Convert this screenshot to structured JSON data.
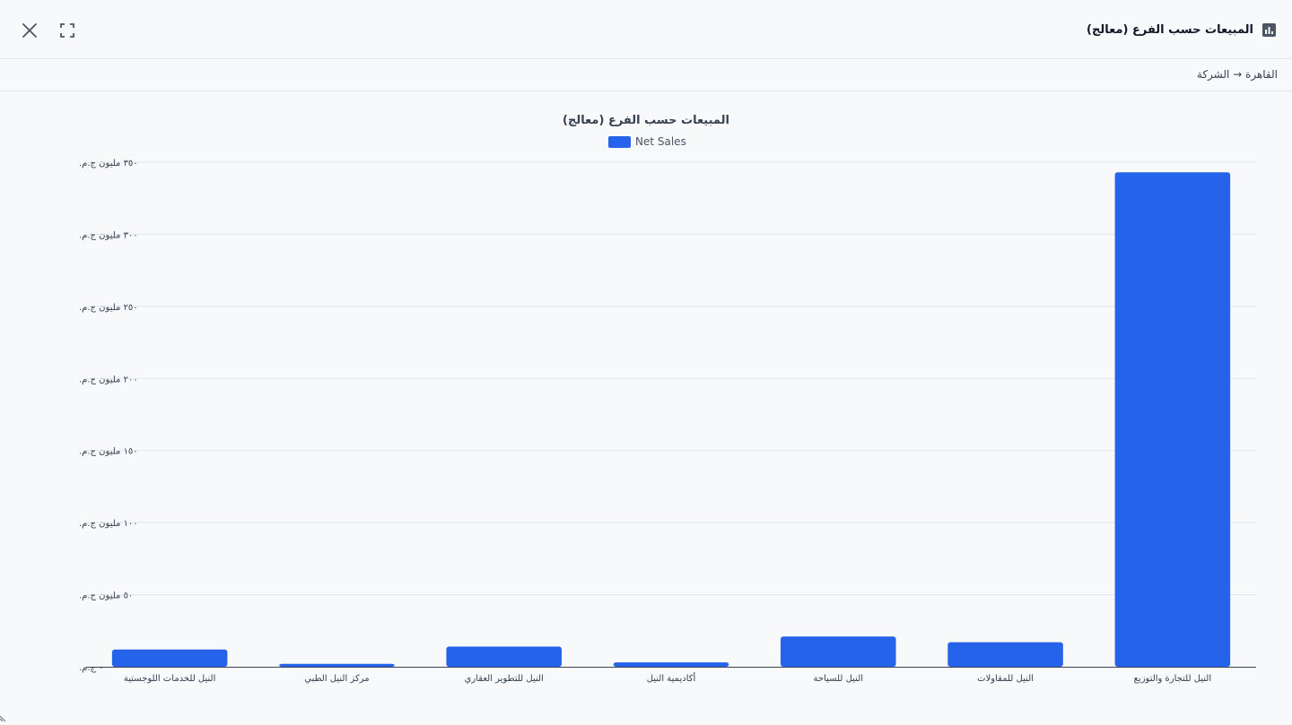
{
  "header": {
    "title": "المبيعات حسب الفرع (معالج)",
    "title_icon": "bar-chart-icon",
    "close_icon": "close-icon",
    "fullscreen_icon": "fullscreen-icon"
  },
  "breadcrumb": "القاهرة → الشركة",
  "colors": {
    "bar": "#2563eb",
    "grid": "#e2e6ea",
    "axis": "#374151",
    "text": "#374151"
  },
  "chart_data": {
    "type": "bar",
    "title": "المبيعات حسب الفرع (معالج)",
    "legend": "top",
    "grid": true,
    "categories": [
      "النيل للخدمات اللوجستية",
      "مركز النيل الطبي",
      "النيل للتطوير العقاري",
      "أكاديمية النيل",
      "النيل للسياحة",
      "النيل للمقاولات",
      "النيل للتجارة والتوزيع"
    ],
    "series": [
      {
        "name": "Net Sales",
        "values": [
          12,
          2,
          14,
          3,
          21,
          17,
          343
        ]
      }
    ],
    "ylim": [
      0,
      350
    ],
    "yticks": [
      0,
      50,
      100,
      150,
      200,
      250,
      300,
      350
    ],
    "ytick_labels": [
      "٠ ج.م.",
      "٥٠ مليون ج.م.",
      "١٠٠ مليون ج.م.",
      "١٥٠ مليون ج.م.",
      "٢٠٠ مليون ج.م.",
      "٢٥٠ مليون ج.م.",
      "٣٠٠ مليون ج.م.",
      "٣٥٠ مليون ج.م."
    ]
  }
}
